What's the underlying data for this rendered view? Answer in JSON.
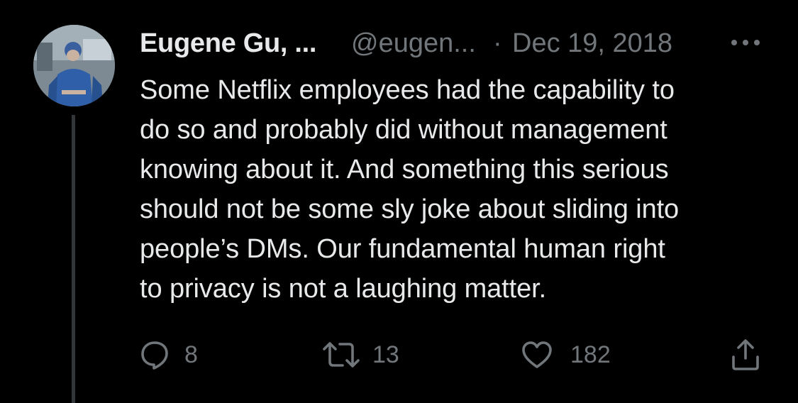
{
  "tweet": {
    "display_name": "Eugene Gu, ...",
    "handle": "@eugen...",
    "separator": "·",
    "date": "Dec 19, 2018",
    "text_lines": [
      "Some Netflix employees had the capability to",
      "do so and probably did without management",
      "knowing about it. And something this serious",
      "should not be some sly joke about sliding into",
      "people’s DMs. Our fundamental human right",
      "to privacy is not a laughing matter."
    ],
    "actions": {
      "replies": "8",
      "retweets": "13",
      "likes": "182"
    }
  },
  "icons": {
    "more": "more-horizontal-icon",
    "reply": "reply-bubble-icon",
    "retweet": "retweet-icon",
    "like": "heart-icon",
    "share": "share-upload-icon"
  },
  "colors": {
    "background": "#000000",
    "primary_text": "#e7e9ea",
    "secondary_text": "#71767b",
    "thread_line": "#333639"
  }
}
